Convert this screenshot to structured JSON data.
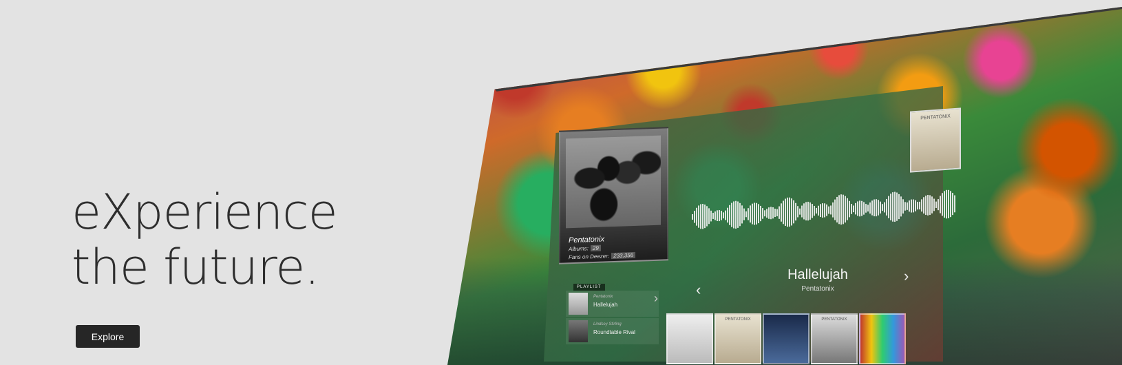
{
  "hero": {
    "line1": "eXperience",
    "line2": "the future.",
    "button_label": "Explore"
  },
  "player": {
    "artist": {
      "name": "Pentatonix",
      "albums_label": "Albums:",
      "albums_value": "29",
      "fans_label": "Fans on Deezer:",
      "fans_value": "233,356"
    },
    "album_top_title": "PENTATONIX",
    "now_playing": {
      "title": "Hallelujah",
      "artist": "Pentatonix"
    },
    "playlist_label": "PLAYLIST",
    "playlist": [
      {
        "sub": "Pentatonix",
        "name": "Hallelujah"
      },
      {
        "sub": "Lindsey Stirling",
        "name": "Roundtable Rival"
      }
    ],
    "strip_labels": [
      "",
      "PENTATONIX",
      "",
      "PENTATONIX",
      ""
    ],
    "icons": [
      "picture-in-picture-icon",
      "users-icon",
      "gear-icon",
      "info-icon",
      "thumbs-up-icon",
      "thumbs-down-icon",
      "heart-icon"
    ]
  },
  "colors": {
    "background": "#e3e3e3",
    "button": "#262626",
    "text": "#2e2e2e"
  }
}
